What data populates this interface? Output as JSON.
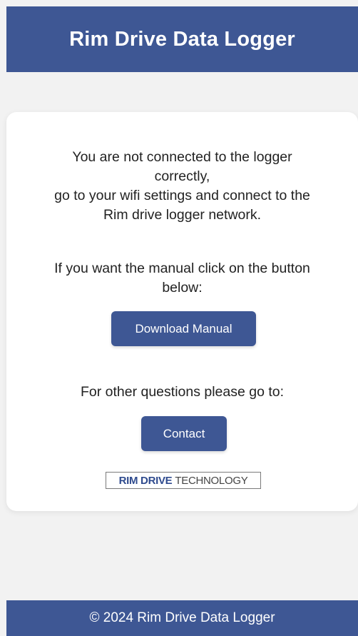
{
  "header": {
    "title": "Rim Drive Data Logger"
  },
  "card": {
    "message_lines": [
      "You are not connected to the logger",
      "correctly,",
      "go to your wifi settings and connect to the",
      "Rim drive logger network."
    ],
    "manual_lines": [
      "If you want the manual click on the button",
      "below:"
    ],
    "download_button_label": "Download Manual",
    "questions_text": "For other questions please go to:",
    "contact_button_label": "Contact",
    "logo": {
      "part1": "RIM DRIVE",
      "part2": "TECHNOLOGY"
    }
  },
  "footer": {
    "text": "© 2024 Rim Drive Data Logger"
  },
  "colors": {
    "primary": "#3e5794",
    "background": "#f2f2f2",
    "card": "#ffffff"
  }
}
